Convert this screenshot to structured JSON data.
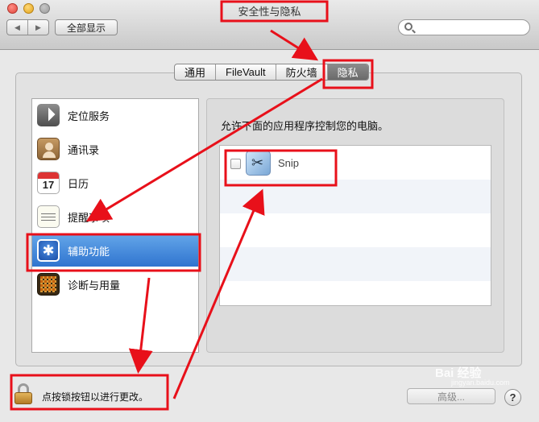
{
  "window": {
    "title": "安全性与隐私",
    "nav_back": "◀",
    "nav_forward": "▶",
    "show_all": "全部显示",
    "search_placeholder": ""
  },
  "tabs": [
    {
      "label": "通用",
      "active": false
    },
    {
      "label": "FileVault",
      "active": false
    },
    {
      "label": "防火墙",
      "active": false
    },
    {
      "label": "隐私",
      "active": true
    }
  ],
  "sidebar": {
    "items": [
      {
        "label": "定位服务",
        "icon": "location-arrow-icon",
        "selected": false
      },
      {
        "label": "通讯录",
        "icon": "contacts-icon",
        "selected": false
      },
      {
        "label": "日历",
        "icon": "calendar-icon",
        "calendar_day": "17",
        "selected": false
      },
      {
        "label": "提醒事项",
        "icon": "reminders-icon",
        "selected": false
      },
      {
        "label": "辅助功能",
        "icon": "accessibility-icon",
        "selected": true
      },
      {
        "label": "诊断与用量",
        "icon": "diagnostics-icon",
        "selected": false
      }
    ]
  },
  "main": {
    "allow_text": "允许下面的应用程序控制您的电脑。",
    "apps": [
      {
        "name": "Snip",
        "checked": false,
        "icon": "snip-scissors-icon"
      }
    ]
  },
  "footer": {
    "lock_text": "点按锁按钮以进行更改。",
    "advanced_label": "高级...",
    "help_label": "?"
  },
  "watermark": {
    "text": "Bai 经验",
    "sub": "jingyan.baidu.com"
  },
  "colors": {
    "annotation_red": "#e8101a",
    "selection_blue": "#3b7fd6"
  }
}
